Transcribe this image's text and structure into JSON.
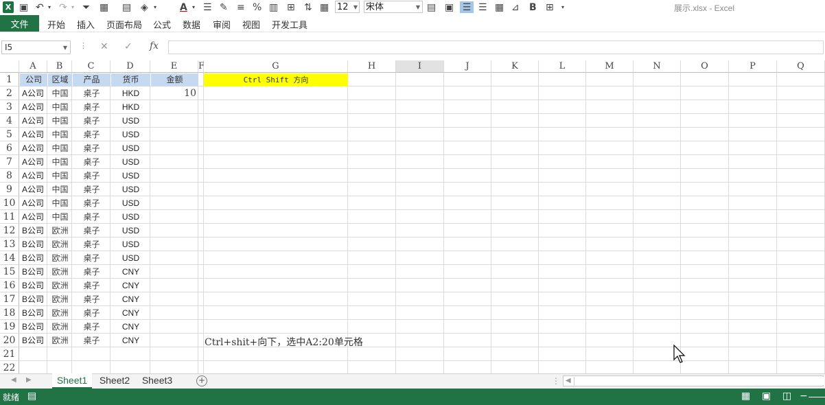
{
  "toolbar": {
    "font_size": "12",
    "font_name": "宋体",
    "icons": [
      "excel-logo",
      "save-icon",
      "undo-icon",
      "redo-icon",
      "filter-icon",
      "number-format-icon",
      "format-cells-icon",
      "fill-color-icon",
      "font-color-icon",
      "align-icon",
      "format-painter-icon",
      "distribute-icon",
      "percent-icon",
      "style-icon",
      "merge-icon",
      "sort-icon",
      "bold-icon"
    ]
  },
  "window": {
    "title": "展示.xlsx - Excel"
  },
  "ribbon": {
    "file_tab": "文件",
    "tabs": [
      "开始",
      "插入",
      "页面布局",
      "公式",
      "数据",
      "审阅",
      "视图",
      "开发工具"
    ]
  },
  "formula_bar": {
    "name_box": "I5",
    "fx_label": "fx",
    "formula": ""
  },
  "grid": {
    "columns": [
      "A",
      "B",
      "C",
      "D",
      "E",
      "F",
      "G",
      "H",
      "I",
      "J",
      "K",
      "L",
      "M",
      "N",
      "O",
      "P",
      "Q"
    ],
    "rows": [
      "1",
      "2",
      "3",
      "4",
      "5",
      "6",
      "7",
      "8",
      "9",
      "10",
      "11",
      "12",
      "13",
      "14",
      "15",
      "16",
      "17",
      "18",
      "19",
      "20",
      "21",
      "22"
    ],
    "headers": {
      "company": "公司",
      "region": "区域",
      "product": "产品",
      "currency": "货币",
      "amount": "金额"
    },
    "g1_label": "Ctrl Shift 方向",
    "e2_value": "10",
    "data_rows": [
      [
        "A公司",
        "中国",
        "桌子",
        "HKD"
      ],
      [
        "A公司",
        "中国",
        "桌子",
        "HKD"
      ],
      [
        "A公司",
        "中国",
        "桌子",
        "USD"
      ],
      [
        "A公司",
        "中国",
        "桌子",
        "USD"
      ],
      [
        "A公司",
        "中国",
        "桌子",
        "USD"
      ],
      [
        "A公司",
        "中国",
        "桌子",
        "USD"
      ],
      [
        "A公司",
        "中国",
        "桌子",
        "USD"
      ],
      [
        "A公司",
        "中国",
        "桌子",
        "USD"
      ],
      [
        "A公司",
        "中国",
        "桌子",
        "USD"
      ],
      [
        "A公司",
        "中国",
        "桌子",
        "USD"
      ],
      [
        "B公司",
        "欧洲",
        "桌子",
        "USD"
      ],
      [
        "B公司",
        "欧洲",
        "桌子",
        "USD"
      ],
      [
        "B公司",
        "欧洲",
        "桌子",
        "USD"
      ],
      [
        "B公司",
        "欧洲",
        "桌子",
        "CNY"
      ],
      [
        "B公司",
        "欧洲",
        "桌子",
        "CNY"
      ],
      [
        "B公司",
        "欧洲",
        "桌子",
        "CNY"
      ],
      [
        "B公司",
        "欧洲",
        "桌子",
        "CNY"
      ],
      [
        "B公司",
        "欧洲",
        "桌子",
        "CNY"
      ],
      [
        "B公司",
        "欧洲",
        "桌子",
        "CNY"
      ]
    ],
    "note": "Ctrl+shit+向下，选中A2:20单元格",
    "header_fill": "#c5d9f1",
    "highlight_fill": "#ffff00"
  },
  "sheets": [
    "Sheet1",
    "Sheet2",
    "Sheet3"
  ],
  "status": {
    "text": "就绪",
    "accent": "#217346"
  }
}
